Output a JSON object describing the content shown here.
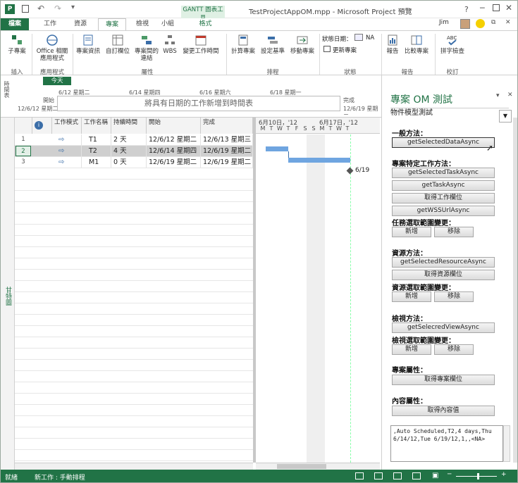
{
  "titlebar": {
    "title": "TestProjectAppOM.mpp - Microsoft Project 預覽",
    "context_tab_group": "GANTT 圖表工具",
    "user": "Jim",
    "help": "?"
  },
  "tabs": [
    "檔案",
    "工作",
    "資源",
    "專案",
    "檢視",
    "小組",
    "格式"
  ],
  "ribbon": {
    "groups": [
      {
        "label": "插入",
        "items": [
          "子專案"
        ]
      },
      {
        "label": "應用程式",
        "items": [
          "Office 相關應用程式"
        ]
      },
      {
        "label": "屬性",
        "items": [
          "專案資訊",
          "自訂欄位",
          "專案間的連結",
          "WBS",
          "變更工作時間"
        ]
      },
      {
        "label": "排程",
        "items": [
          "計算專案",
          "設定基準",
          "移動專案"
        ]
      },
      {
        "label": "狀態",
        "items": [
          "狀態日期：",
          "NA",
          "更新專案"
        ]
      },
      {
        "label": "報告",
        "items": [
          "報告",
          "比較專案"
        ]
      },
      {
        "label": "校訂",
        "items": [
          "拼字檢查"
        ]
      }
    ]
  },
  "timeline": {
    "side_label": "時間表",
    "today": "今天",
    "start_label": "開始",
    "start_date": "12/6/12 星期二",
    "finish_label": "完成",
    "finish_date": "12/6/19 星期二",
    "ticks": [
      "6/12 星期二",
      "6/14 星期四",
      "6/16 星期六",
      "6/18 星期一"
    ],
    "placeholder": "將具有日期的工作新增到時間表"
  },
  "grid": {
    "side_label": "甘特圖",
    "columns": [
      "工作模式",
      "工作名稱",
      "持續時間",
      "開始",
      "完成"
    ],
    "rows": [
      {
        "num": "1",
        "name": "T1",
        "duration": "2 天",
        "start": "12/6/12 星期二",
        "finish": "12/6/13 星期三"
      },
      {
        "num": "2",
        "name": "T2",
        "duration": "4 天",
        "start": "12/6/14 星期四",
        "finish": "12/6/19 星期二"
      },
      {
        "num": "3",
        "name": "M1",
        "duration": "0 天",
        "start": "12/6/19 星期二",
        "finish": "12/6/19 星期二"
      }
    ],
    "gantt_weeks": [
      "6月10日，'12",
      "6月17日，'12"
    ],
    "gantt_days": [
      "M",
      "T",
      "W",
      "T",
      "F",
      "S",
      "S",
      "M",
      "T",
      "W",
      "T"
    ],
    "milestone_label": "6/19"
  },
  "pane": {
    "title": "專案 OM 測試",
    "dropdown": "物件模型測試",
    "sections": {
      "general": "一般方法：",
      "project_methods": "專案特定工作方法：",
      "task_sel": "任務選取範圍變更：",
      "resource_methods": "資源方法：",
      "resource_sel": "資源選取範圍變更：",
      "view_methods": "檢視方法：",
      "view_sel": "檢視選取範圍變更：",
      "project_props": "專案屬性：",
      "content_props": "內容屬性："
    },
    "buttons": {
      "getSelectedDataAsync": "getSelectedDataAsync",
      "getSelectedTaskAsync": "getSelectedTaskAsync",
      "getTaskAsync": "getTaskAsync",
      "getTaskField": "取得工作欄位",
      "getWSSUrlAsync": "getWSSUrlAsync",
      "add": "新增",
      "remove": "移除",
      "getSelectedResourceAsync": "getSelectedResourceAsync",
      "getResourceField": "取得資源欄位",
      "getSelectedViewAsync": "getSelecredViewAsync",
      "getProjectField": "取得專案欄位",
      "getContent": "取得內容值"
    },
    "output": ",Auto Scheduled,T2,4 days,Thu 6/14/12,Tue 6/19/12,1,,<NA>"
  },
  "status": {
    "ready": "就緒",
    "new_tasks": "新工作 : 手動排程"
  }
}
